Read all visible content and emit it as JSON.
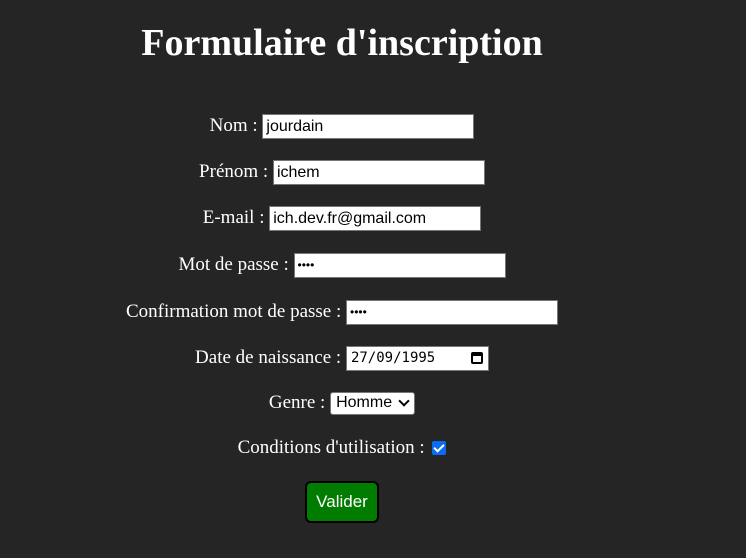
{
  "form": {
    "title": "Formulaire d'inscription",
    "nom": {
      "label": "Nom : ",
      "value": "jourdain"
    },
    "prenom": {
      "label": "Prénom : ",
      "value": "ichem"
    },
    "email": {
      "label": "E-mail : ",
      "value": "ich.dev.fr@gmail.com"
    },
    "password": {
      "label": "Mot de passe : ",
      "value": "••••"
    },
    "password_confirm": {
      "label": "Confirmation mot de passe : ",
      "value": "••••"
    },
    "birthdate": {
      "label": "Date de naissance : ",
      "value": "27/09/1995"
    },
    "gender": {
      "label": "Genre : ",
      "value": "Homme"
    },
    "terms": {
      "label": "Conditions d'utilisation : ",
      "checked": true
    },
    "submit_label": "Valider"
  },
  "colors": {
    "background": "#252525",
    "submit_button": "#007d00",
    "checkbox": "#0b6bf2"
  },
  "icons": [
    "calendar-icon",
    "chevron-down-icon",
    "checkmark-icon"
  ]
}
